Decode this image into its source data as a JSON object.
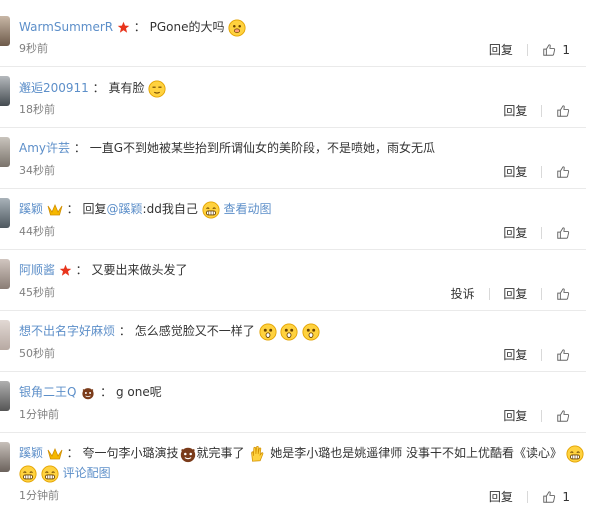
{
  "comments": [
    {
      "author": "WarmSummerR",
      "colon": "：",
      "text": "PGone的大吗",
      "time": "9秒前",
      "reply_label": "回复",
      "like_count": "1"
    },
    {
      "author": "邂逅200911",
      "colon": "：",
      "text": "真有脸",
      "time": "18秒前",
      "reply_label": "回复"
    },
    {
      "author": "Amy许芸",
      "colon": "：",
      "text": "一直G不到她被某些抬到所谓仙女的美阶段，不是喷她，雨女无瓜",
      "time": "34秒前",
      "reply_label": "回复"
    },
    {
      "author": "蹊颖",
      "colon": "：",
      "text_prefix": "回复",
      "mention": "@蹊颖",
      "text": ":dd我自己",
      "view_anim": "查看动图",
      "time": "44秒前",
      "reply_label": "回复"
    },
    {
      "author": "阿顺酱",
      "colon": "：",
      "text": "又要出来做头发了",
      "time": "45秒前",
      "report_label": "投诉",
      "reply_label": "回复"
    },
    {
      "author": "想不出名字好麻烦",
      "colon": "：",
      "text": "怎么感觉脸又不一样了",
      "time": "50秒前",
      "reply_label": "回复"
    },
    {
      "author": "银角二王Q",
      "colon": "：",
      "text": "g one呢",
      "time": "1分钟前",
      "reply_label": "回复"
    },
    {
      "author": "蹊颖",
      "colon": "：",
      "text_a": "夸一句李小璐演技",
      "text_b": "就完事了",
      "text_c": "她是李小璐也是姚遥律师 没事干不如上优酷看《读心》",
      "view_pic": "评论配图",
      "time": "1分钟前",
      "reply_label": "回复",
      "like_count": "1"
    }
  ],
  "colors": {
    "name": "#eb7350",
    "link": "#5d8fc9",
    "muted": "#808080"
  },
  "icons": {
    "like": "thumbs-up-icon",
    "star_badge": "red-star-icon",
    "vip_badge": "vip-crown-icon",
    "emoji": "grin-emoji"
  }
}
